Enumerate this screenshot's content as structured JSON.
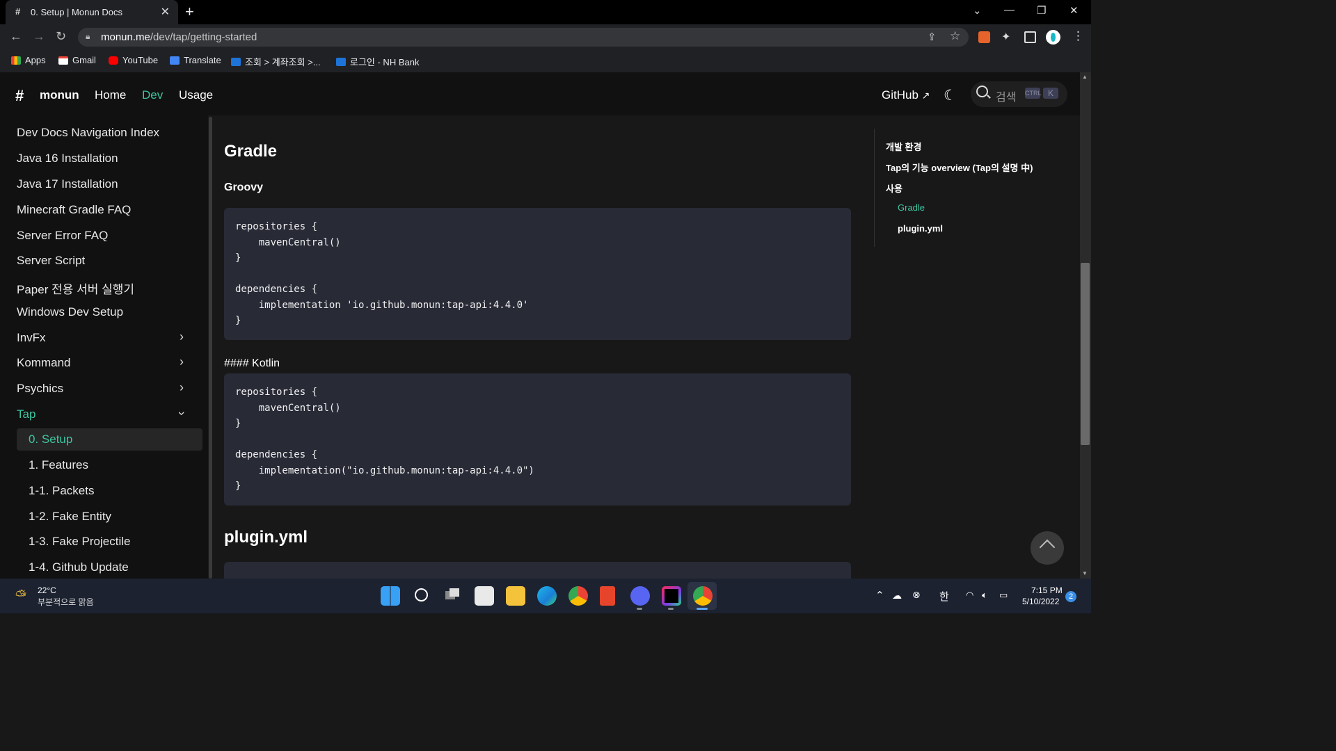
{
  "browser": {
    "tab_title": "0. Setup | Monun Docs",
    "tab_favicon": "#",
    "url_host": "monun.me",
    "url_path": "/dev/tap/getting-started",
    "new_tab": "+",
    "window_controls": [
      "⌄",
      "—",
      "❐",
      "✕"
    ]
  },
  "bookmarks": [
    {
      "label": "Apps",
      "icon": "apps-grid-icon",
      "color": "#4285f4"
    },
    {
      "label": "Gmail",
      "icon": "gmail-icon",
      "color": "#ea4335"
    },
    {
      "label": "YouTube",
      "icon": "youtube-icon",
      "color": "#ff0000"
    },
    {
      "label": "Translate",
      "icon": "translate-icon",
      "color": "#4285f4"
    },
    {
      "label": "조회 > 계좌조회 >...",
      "icon": "nh-icon",
      "color": "#1e73d8"
    },
    {
      "label": "로그인 - NH Bank",
      "icon": "nh-icon",
      "color": "#1e73d8"
    }
  ],
  "site": {
    "brand": "monun",
    "nav": [
      "Home",
      "Dev",
      "Usage"
    ],
    "active_nav": "Dev",
    "github": "GitHub",
    "search_placeholder": "검색",
    "kbd_ctrl": "CTRL",
    "kbd_k": "K",
    "accent": "#3ec5a0"
  },
  "sidebar": {
    "items": [
      {
        "label": "Dev Docs Navigation Index"
      },
      {
        "label": "Java 16 Installation"
      },
      {
        "label": "Java 17 Installation"
      },
      {
        "label": "Minecraft Gradle FAQ"
      },
      {
        "label": "Server Error FAQ"
      },
      {
        "label": "Server Script"
      },
      {
        "label": "Paper 전용 서버 실행기"
      },
      {
        "label": "Windows Dev Setup"
      },
      {
        "label": "InvFx",
        "expandable": true
      },
      {
        "label": "Kommand",
        "expandable": true
      },
      {
        "label": "Psychics",
        "expandable": true
      },
      {
        "label": "Tap",
        "expanded": true
      }
    ],
    "sub_items": [
      {
        "label": "0. Setup",
        "active": true
      },
      {
        "label": "1. Features"
      },
      {
        "label": "1-1. Packets"
      },
      {
        "label": "1-2. Fake Entity"
      },
      {
        "label": "1-3. Fake Projectile"
      },
      {
        "label": "1-4. Github Update"
      }
    ]
  },
  "content": {
    "h2_gradle": "Gradle",
    "h3_groovy": "Groovy",
    "code_groovy": "repositories {\n    mavenCentral()\n}\n\ndependencies {\n    implementation 'io.github.monun:tap-api:4.4.0'\n}",
    "kotlin_heading": "#### Kotlin",
    "code_kotlin": "repositories {\n    mavenCentral()\n}\n\ndependencies {\n    implementation(\"io.github.monun:tap-api:4.4.0\")\n}",
    "h2_plugin": "plugin.yml"
  },
  "toc": {
    "items": [
      {
        "label": "개발 환경",
        "level": 1
      },
      {
        "label": "Tap의 기능 overview (Tap의 설명 中)",
        "level": 1
      },
      {
        "label": "사용",
        "level": 1
      },
      {
        "label": "Gradle",
        "level": 2,
        "active": true
      },
      {
        "label": "plugin.yml",
        "level": 2
      }
    ]
  },
  "taskbar": {
    "weather_temp": "22°C",
    "weather_desc": "부분적으로 맑음",
    "ime": "한",
    "time": "7:15 PM",
    "date": "5/10/2022",
    "notifications": "2"
  }
}
